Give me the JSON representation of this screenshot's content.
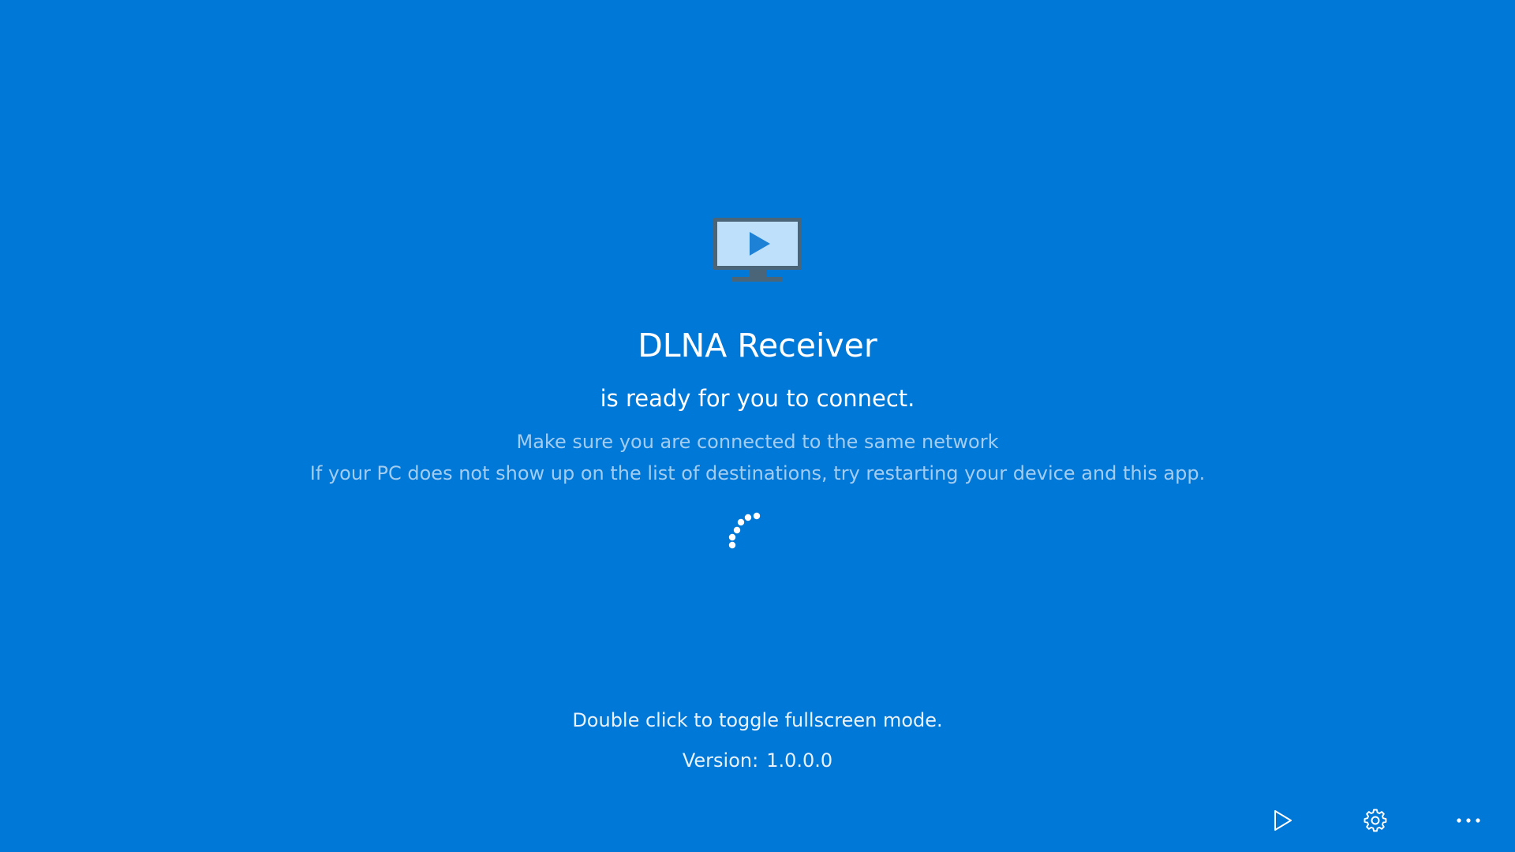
{
  "app": {
    "title": "DLNA Receiver",
    "status": "is ready for you to connect.",
    "hints": [
      "Make sure you are connected to the same network",
      "If your PC does not show up on the list of destinations, try restarting your device and this app."
    ],
    "fullscreen_hint": "Double click to toggle fullscreen mode.",
    "version_label": "Version:",
    "version_value": "1.0.0.0"
  },
  "icons": {
    "hero": "tv-play-icon",
    "spinner": "loading-spinner-icon"
  },
  "command_bar": {
    "buttons": [
      {
        "name": "play-button",
        "icon": "play-icon"
      },
      {
        "name": "settings-button",
        "icon": "gear-icon"
      },
      {
        "name": "more-button",
        "icon": "more-dots-icon"
      }
    ]
  },
  "colors": {
    "background": "#0078d7",
    "text_primary": "#ffffff",
    "text_secondary": "#a3cdf0",
    "tv_frame": "#4a6478",
    "tv_screen": "#bfe0fb",
    "tv_play": "#1d82d6"
  }
}
